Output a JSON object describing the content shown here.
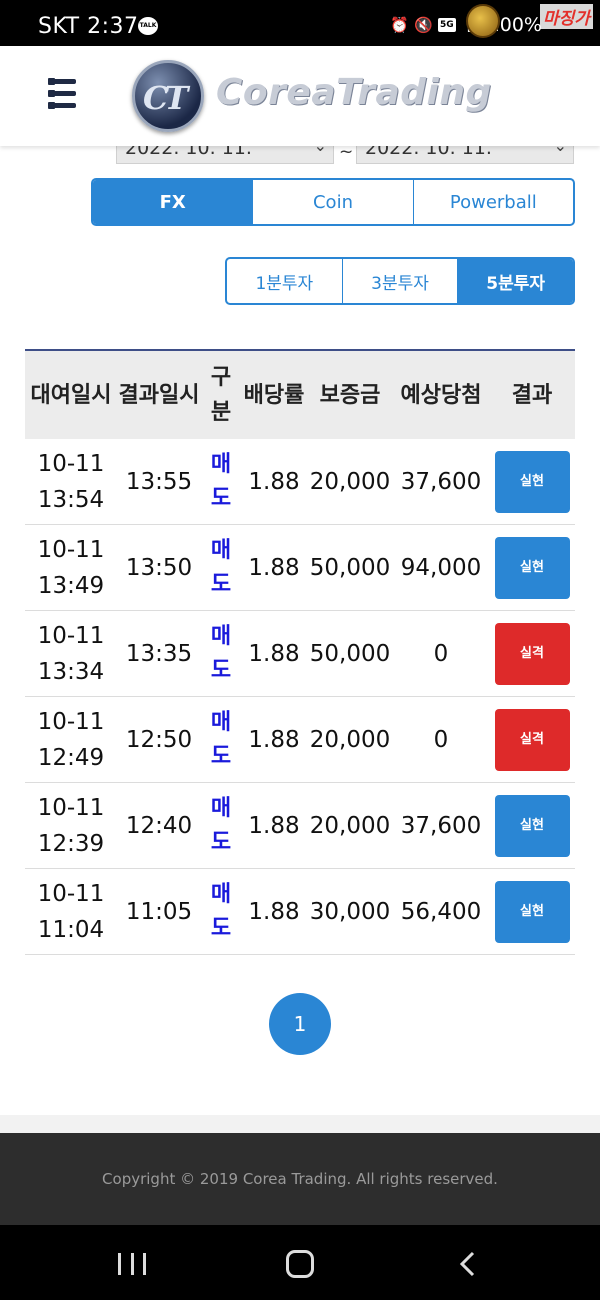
{
  "status_bar": {
    "carrier_time": "SKT 2:37",
    "talk_icon": "TALK",
    "network": "5G",
    "battery": "100%",
    "watermark": "마징가"
  },
  "header": {
    "menu_icon": "hamburger-menu-icon",
    "logo_mark": "CT",
    "logo_text": "CoreaTrading"
  },
  "date_range": {
    "from": "2022. 10. 11.",
    "separator": "~",
    "to": "2022. 10. 11."
  },
  "market_tabs": [
    {
      "label": "FX",
      "active": true
    },
    {
      "label": "Coin",
      "active": false
    },
    {
      "label": "Powerball",
      "active": false
    }
  ],
  "interval_tabs": [
    {
      "label": "1분투자",
      "active": false
    },
    {
      "label": "3분투자",
      "active": false
    },
    {
      "label": "5분투자",
      "active": true
    }
  ],
  "table": {
    "headers": {
      "entry_time": "대여일시",
      "result_time": "결과일시",
      "type": "구분",
      "odds": "배당률",
      "deposit": "보증금",
      "expected": "예상당첨",
      "result": "결과"
    },
    "rows": [
      {
        "entry_date": "10-11",
        "entry_time": "13:54",
        "result_time": "13:55",
        "type": "매도",
        "odds": "1.88",
        "deposit": "20,000",
        "expected": "37,600",
        "result": "실현"
      },
      {
        "entry_date": "10-11",
        "entry_time": "13:49",
        "result_time": "13:50",
        "type": "매도",
        "odds": "1.88",
        "deposit": "50,000",
        "expected": "94,000",
        "result": "실현"
      },
      {
        "entry_date": "10-11",
        "entry_time": "13:34",
        "result_time": "13:35",
        "type": "매도",
        "odds": "1.88",
        "deposit": "50,000",
        "expected": "0",
        "result": "실격"
      },
      {
        "entry_date": "10-11",
        "entry_time": "12:49",
        "result_time": "12:50",
        "type": "매도",
        "odds": "1.88",
        "deposit": "20,000",
        "expected": "0",
        "result": "실격"
      },
      {
        "entry_date": "10-11",
        "entry_time": "12:39",
        "result_time": "12:40",
        "type": "매도",
        "odds": "1.88",
        "deposit": "20,000",
        "expected": "37,600",
        "result": "실현"
      },
      {
        "entry_date": "10-11",
        "entry_time": "11:04",
        "result_time": "11:05",
        "type": "매도",
        "odds": "1.88",
        "deposit": "30,000",
        "expected": "56,400",
        "result": "실현"
      }
    ]
  },
  "pagination": {
    "current": "1"
  },
  "footer": {
    "copyright": "Copyright © 2019 Corea Trading. All rights reserved."
  },
  "colors": {
    "accent": "#2a86d4",
    "win": "#2a86d4",
    "lose": "#de2a2a",
    "type_text": "#1a1adb",
    "footer_bg": "#2d2d2d"
  }
}
